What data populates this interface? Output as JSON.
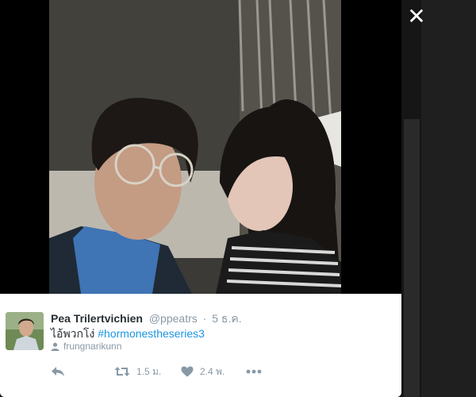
{
  "close": {
    "label": "✕"
  },
  "tweet": {
    "fullname": "Pea Trilertvichien",
    "username": "@ppeatrs",
    "separator": "·",
    "time": "5 ธ.ค.",
    "text_plain": "ไอ้พวกโง่ ",
    "hashtag": "#hormonestheseries3",
    "tagged_user": "frungnarikunn",
    "actions": {
      "retweet_count": "1.5 ม.",
      "like_count": "2.4 พ."
    }
  },
  "icons": {
    "reply": "reply-icon",
    "retweet": "retweet-icon",
    "like": "heart-icon",
    "more": "more-icon",
    "tagged": "person-icon",
    "close": "close-icon"
  },
  "colors": {
    "hashtag": "#1b95e0",
    "muted": "#8899a6",
    "text": "#292f33"
  }
}
